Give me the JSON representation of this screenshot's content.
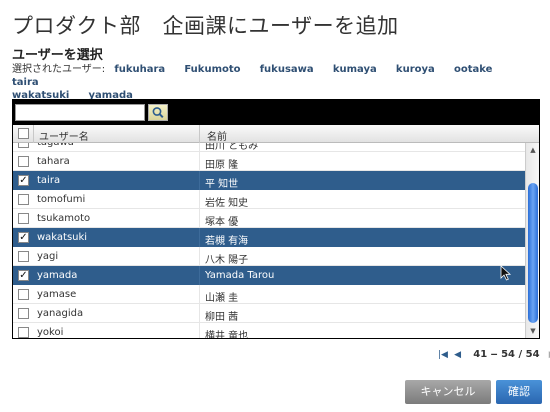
{
  "page": {
    "title": "プロダクト部　企画課にユーザーを追加"
  },
  "section": {
    "heading": "ユーザーを選択"
  },
  "selection": {
    "label": "選択されたユーザー:",
    "users": [
      "fukuhara",
      "Fukumoto",
      "fukusawa",
      "kumaya",
      "kuroya",
      "ootake",
      "taira",
      "wakatsuki",
      "yamada"
    ]
  },
  "search": {
    "value": "",
    "icon": "search-icon"
  },
  "table": {
    "columns": [
      "ユーザー名",
      "名前"
    ],
    "rows": [
      {
        "user": "tagawa",
        "name": "田川 ともみ",
        "checked": false
      },
      {
        "user": "tahara",
        "name": "田原 隆",
        "checked": false
      },
      {
        "user": "taira",
        "name": "平 知世",
        "checked": true
      },
      {
        "user": "tomofumi",
        "name": "岩佐 知史",
        "checked": false
      },
      {
        "user": "tsukamoto",
        "name": "塚本 優",
        "checked": false
      },
      {
        "user": "wakatsuki",
        "name": "若槻 有海",
        "checked": true
      },
      {
        "user": "yagi",
        "name": "八木 陽子",
        "checked": false
      },
      {
        "user": "yamada",
        "name": "Yamada Tarou",
        "checked": true
      },
      {
        "user": "yamase",
        "name": "山瀬 圭",
        "checked": false
      },
      {
        "user": "yanagida",
        "name": "柳田 茜",
        "checked": false
      },
      {
        "user": "yokoi",
        "name": "横井 竜也",
        "checked": false
      }
    ]
  },
  "pager": {
    "range": "41 ‒ 54 / 54"
  },
  "buttons": {
    "cancel": "キャンセル",
    "ok": "確認"
  },
  "colors": {
    "selected_row": "#2f5d8c",
    "link": "#2f4f73",
    "ok_button": "#2a66b0",
    "cancel_button": "#7b7b7b"
  }
}
